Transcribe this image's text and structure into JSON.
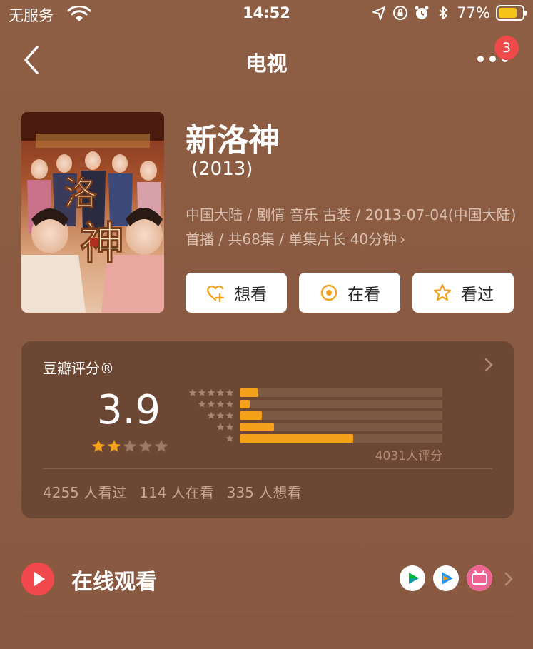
{
  "status_bar": {
    "carrier": "无服务",
    "time": "14:52",
    "battery": "77%"
  },
  "nav": {
    "title": "电视",
    "badge": "3"
  },
  "movie": {
    "title": "新洛神",
    "year": "(2013)",
    "meta": "中国大陆 / 剧情 音乐 古装 / 2013-07-04(中国大陆) 首播 / 共68集 / 单集片长 40分钟",
    "meta_arrow": "›"
  },
  "actions": [
    {
      "label": "想看",
      "icon": "heart-plus-icon"
    },
    {
      "label": "在看",
      "icon": "target-icon"
    },
    {
      "label": "看过",
      "icon": "star-outline-icon"
    }
  ],
  "rating": {
    "title": "豆瓣评分®",
    "score": "3.9",
    "stars_filled": 2,
    "stars_total": 5,
    "distribution": [
      {
        "stars": 5,
        "fraction": 0.09
      },
      {
        "stars": 4,
        "fraction": 0.05
      },
      {
        "stars": 3,
        "fraction": 0.11
      },
      {
        "stars": 2,
        "fraction": 0.17
      },
      {
        "stars": 1,
        "fraction": 0.56
      }
    ],
    "count_text": "4031人评分",
    "stats": {
      "watched": "4255 人看过",
      "watching": "114 人在看",
      "want": "335 人想看"
    }
  },
  "online": {
    "label": "在线观看",
    "platforms": [
      "iqiyi-icon",
      "tencent-video-icon",
      "bilibili-icon"
    ]
  },
  "colors": {
    "background": "#8a5b42",
    "card": "#6c4733",
    "accent": "#f5a11c",
    "badge": "#f0494a"
  }
}
